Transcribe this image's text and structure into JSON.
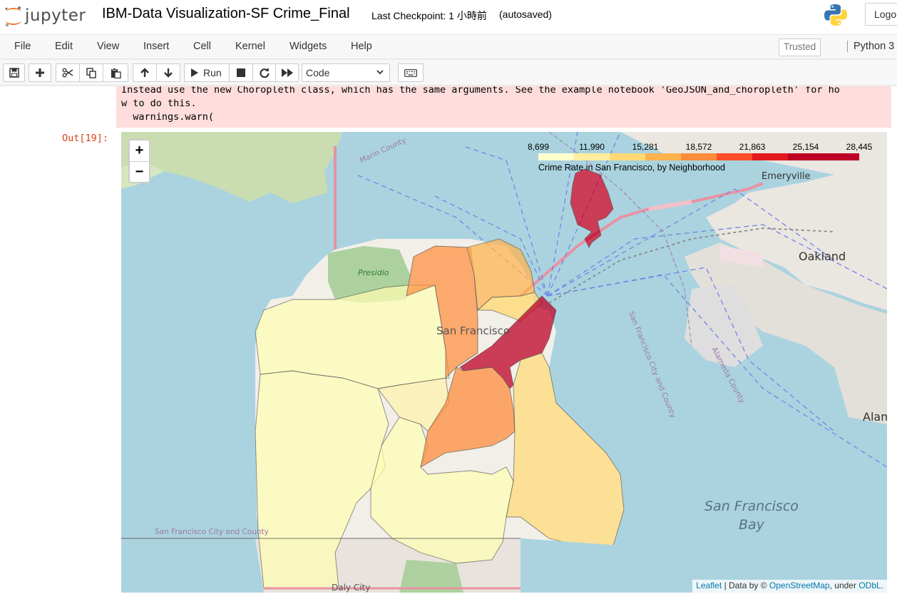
{
  "header": {
    "logo_text": "jupyter",
    "notebook_title": "IBM-Data Visualization-SF Crime_Final",
    "checkpoint": "Last Checkpoint: 1 小時前",
    "autosave": "(autosaved)",
    "logout_label": "Logou"
  },
  "menubar": {
    "items": [
      "File",
      "Edit",
      "View",
      "Insert",
      "Cell",
      "Kernel",
      "Widgets",
      "Help"
    ],
    "trusted_label": "Trusted",
    "kernel_label": "Python 3"
  },
  "toolbar": {
    "run_label": "Run",
    "cell_type": "Code",
    "icons": [
      "save-icon",
      "plus-icon",
      "cut-icon",
      "copy-icon",
      "paste-icon",
      "arrow-up-icon",
      "arrow-down-icon",
      "run-icon",
      "stop-icon",
      "restart-icon",
      "fast-forward-icon",
      "keyboard-icon"
    ]
  },
  "cell": {
    "warning_text": "Instead use the new Choropleth class, which has the same arguments. See the example notebook 'GeoJSON_and_choropleth' for ho\nw to do this.\n  warnings.warn(",
    "out_prompt": "Out[19]:"
  },
  "map": {
    "zoom_in": "+",
    "zoom_out": "−",
    "legend": {
      "ticks": [
        "8,699",
        "11,990",
        "15,281",
        "18,572",
        "21,863",
        "25,154",
        "28,445"
      ],
      "caption": "Crime Rate in San Francisco, by Neighborhood",
      "colors": [
        "#ffffcc",
        "#ffeda0",
        "#fed976",
        "#feb24c",
        "#fd8d3c",
        "#fc4e2a",
        "#e31a1c",
        "#bd0026",
        "#bd0026"
      ]
    },
    "labels": {
      "san_francisco": "San Francisco",
      "sf_bay": "San Francisco\nBay",
      "oakland": "Oakland",
      "emeryville": "Emeryville",
      "alameda": "Alam",
      "presidio": "Presidio",
      "marin_county": "Marin County",
      "sf_city_county": "San Francisco City and County",
      "sf_city_county_vertical": "San Francisco City and County",
      "alameda_county": "Alameda County",
      "daly_city": "Daly City"
    },
    "attribution": {
      "leaflet": "Leaflet",
      "data_by": " | Data by © ",
      "osm": "OpenStreetMap",
      "under": ", under ",
      "odbl": "ODbL."
    }
  }
}
